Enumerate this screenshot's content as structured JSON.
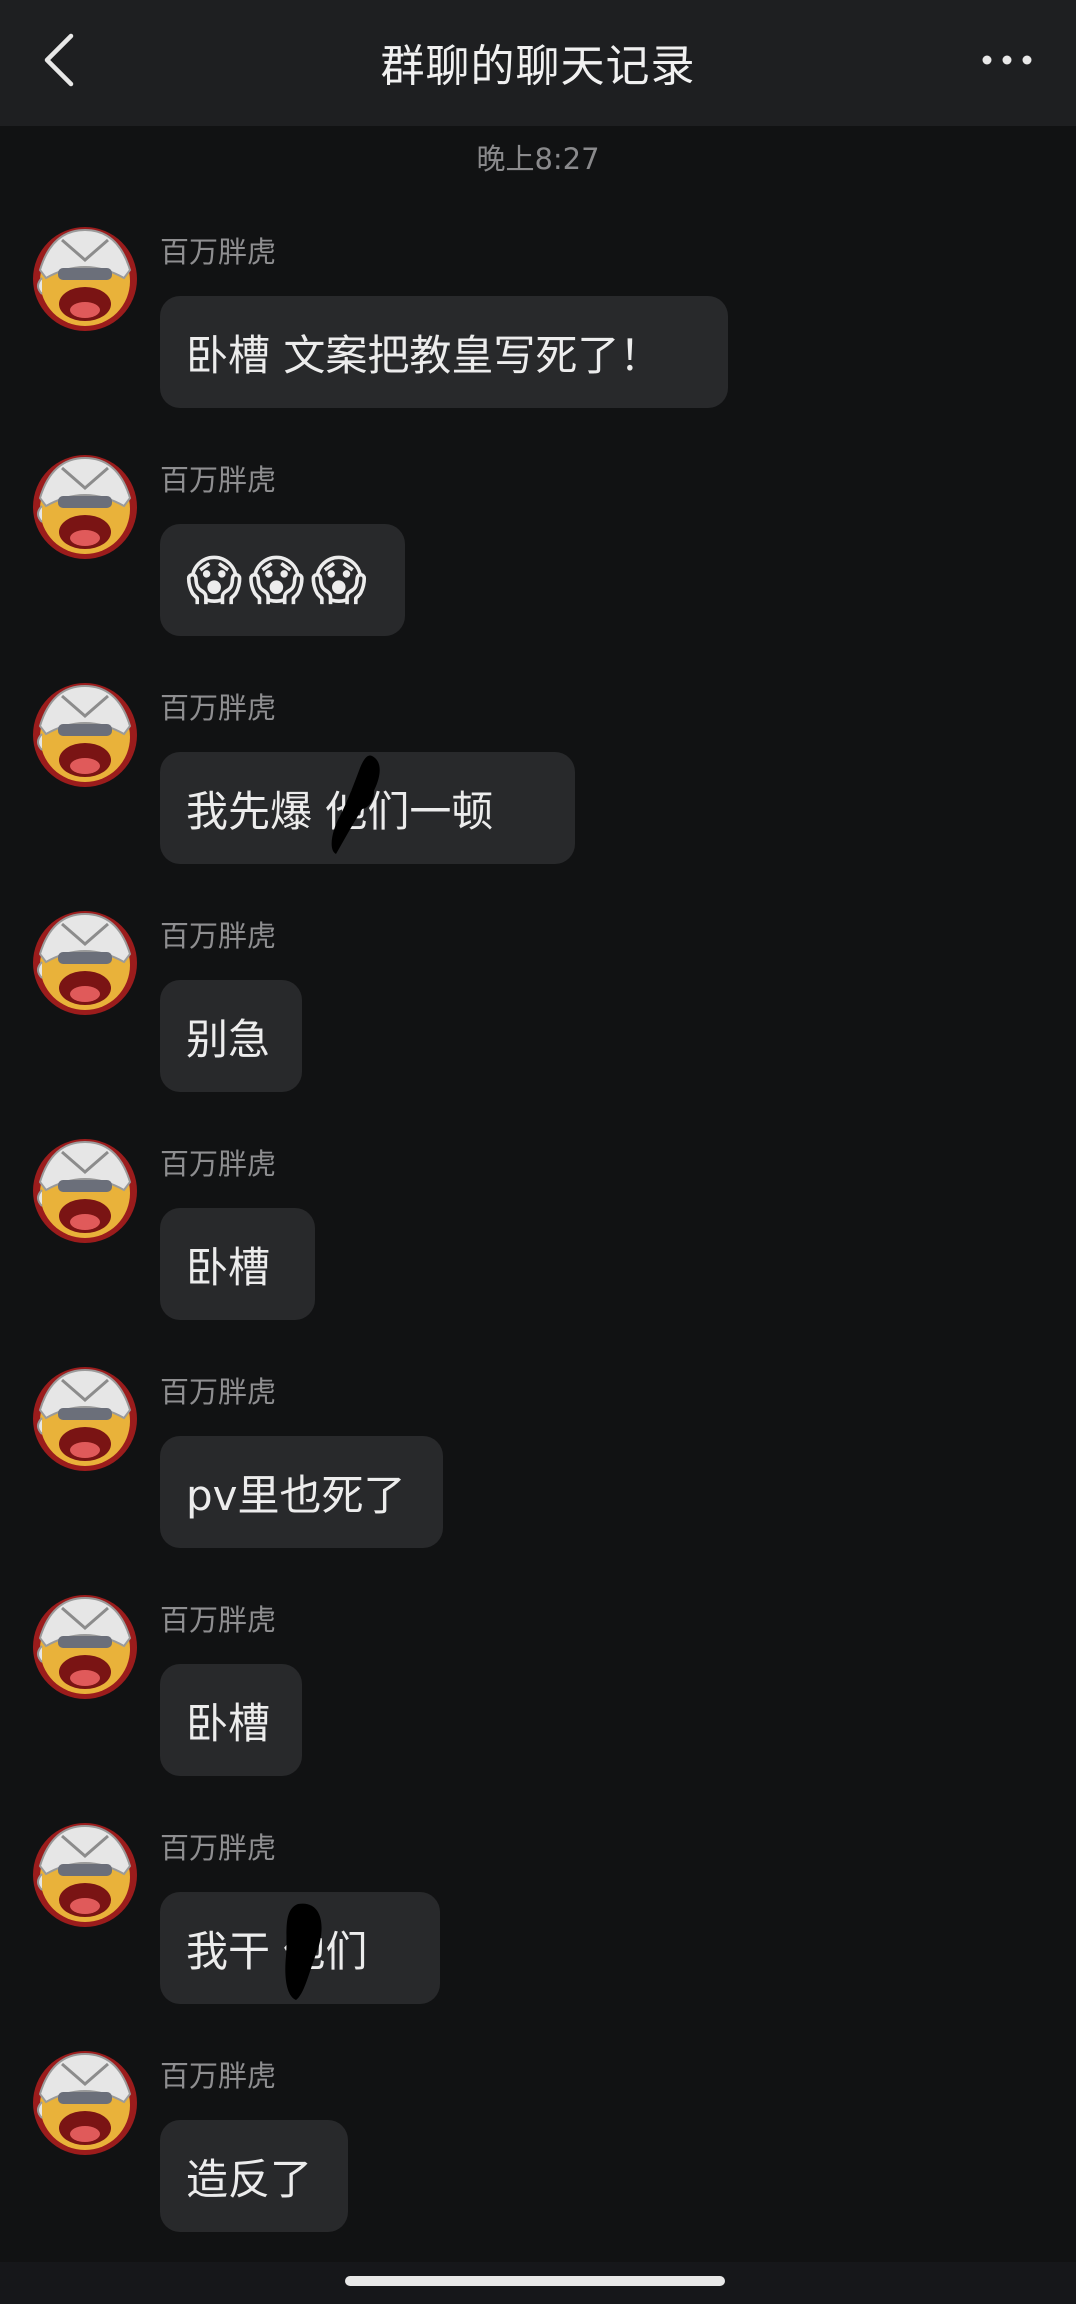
{
  "header": {
    "title": "群聊的聊天记录",
    "back_icon": "chevron-left-icon",
    "more_icon": "more-dots-icon"
  },
  "timestamp": "晚上8:27",
  "messages": [
    {
      "sender": "百万胖虎",
      "text": "卧槽 文案把教皇写死了！"
    },
    {
      "sender": "百万胖虎",
      "text": "",
      "emojis": [
        "😱",
        "😱",
        "😱"
      ]
    },
    {
      "sender": "百万胖虎",
      "text": "我先爆  他们一顿"
    },
    {
      "sender": "百万胖虎",
      "text": "别急"
    },
    {
      "sender": "百万胖虎",
      "text": "卧槽"
    },
    {
      "sender": "百万胖虎",
      "text": "pv里也死了"
    },
    {
      "sender": "百万胖虎",
      "text": "卧槽"
    },
    {
      "sender": "百万胖虎",
      "text": "我干  他们"
    },
    {
      "sender": "百万胖虎",
      "text": "造反了"
    }
  ],
  "colors": {
    "background": "#111213",
    "header": "#1e1f21",
    "bubble": "#28292b",
    "text": "#ececec",
    "meta": "#8e8e90"
  }
}
